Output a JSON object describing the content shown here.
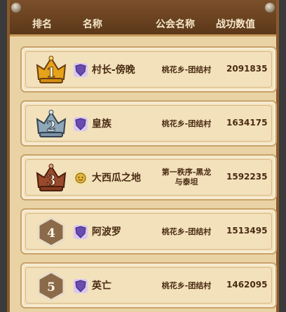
{
  "header": {
    "col_rank": "排名",
    "col_name": "名称",
    "col_guild": "公会名称",
    "col_power": "战功数值"
  },
  "rows": [
    {
      "rank": "1",
      "name": "村长-傍晚",
      "guild": "桃花乡-团结村",
      "power": "2091835",
      "badge": "gold-crown",
      "icon": "purple-shield-icon"
    },
    {
      "rank": "2",
      "name": "皇族",
      "guild": "桃花乡-团结村",
      "power": "1634175",
      "badge": "silver-crown",
      "icon": "purple-shield-icon"
    },
    {
      "rank": "3",
      "name": "大西瓜之地",
      "guild": "第一秩序-黑龙与泰坦",
      "power": "1592235",
      "badge": "bronze-crown",
      "icon": "gold-face-icon"
    },
    {
      "rank": "4",
      "name": "阿波罗",
      "guild": "桃花乡-团结村",
      "power": "1513495",
      "badge": "hexagon",
      "icon": "purple-shield-icon"
    },
    {
      "rank": "5",
      "name": "英亡",
      "guild": "桃花乡-团结村",
      "power": "1462095",
      "badge": "hexagon",
      "icon": "purple-shield-icon"
    }
  ],
  "colors": {
    "gold": "#e6a21a",
    "silver": "#8fa7b9",
    "bronze": "#9a4a2c",
    "hex": "#8b6a4a",
    "purple": "#6a4bb0"
  }
}
